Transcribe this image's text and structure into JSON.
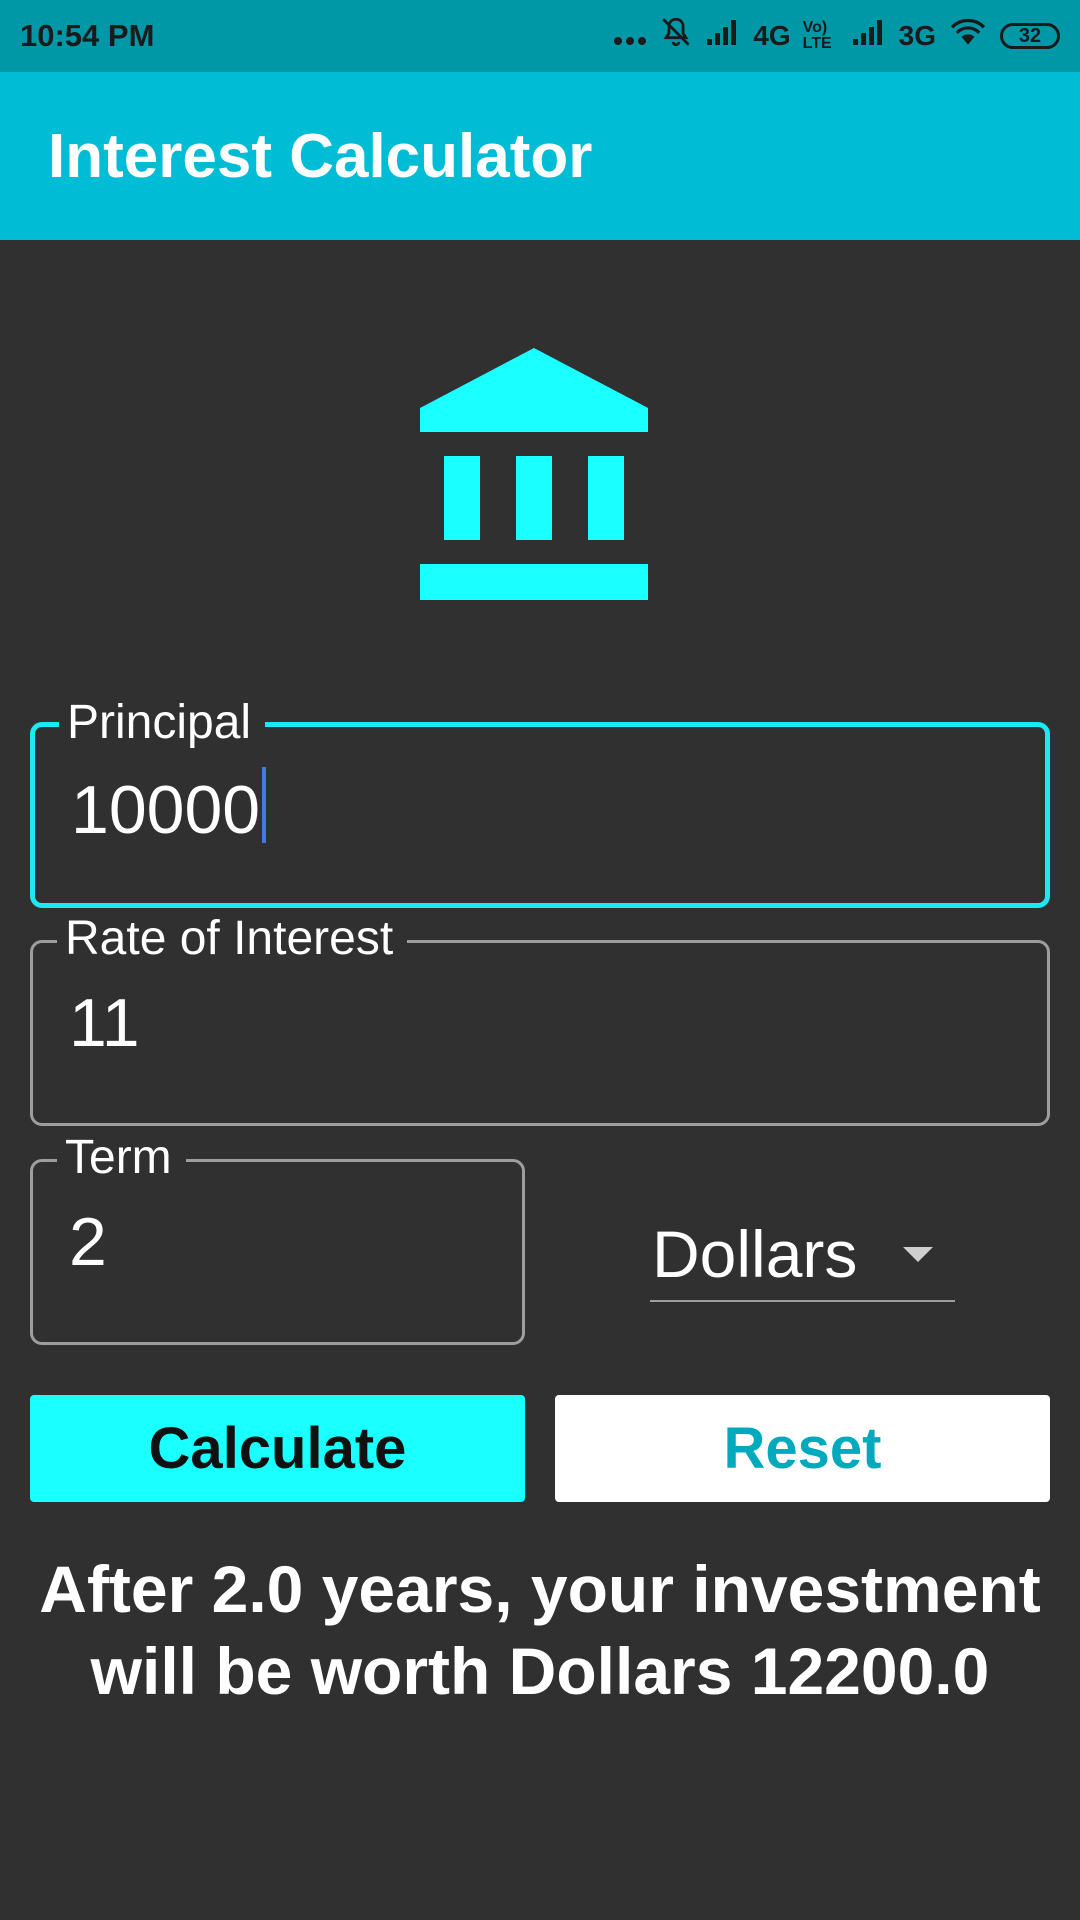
{
  "status_bar": {
    "time": "10:54 PM",
    "network_1": "4G",
    "volte": "Vo) LTE",
    "network_2": "3G",
    "battery": "32",
    "icons": [
      "more-dots-icon",
      "muted-bell-icon",
      "signal-icon",
      "signal-icon",
      "wifi-icon",
      "battery-icon"
    ]
  },
  "app_bar": {
    "title": "Interest Calculator"
  },
  "header_icon": "bank-icon",
  "colors": {
    "accent": "#1de9f2",
    "app_bar": "#00bcd4",
    "status_bar": "#0097a7",
    "background": "#303030"
  },
  "form": {
    "principal": {
      "label": "Principal",
      "value": "10000"
    },
    "rate": {
      "label": "Rate of Interest",
      "value": "11"
    },
    "term": {
      "label": "Term",
      "value": "2"
    },
    "currency": {
      "selected": "Dollars"
    }
  },
  "buttons": {
    "calculate": "Calculate",
    "reset": "Reset"
  },
  "result": {
    "line1": "After 2.0 years, your investment",
    "line2": "will be worth Dollars 12200.0"
  }
}
